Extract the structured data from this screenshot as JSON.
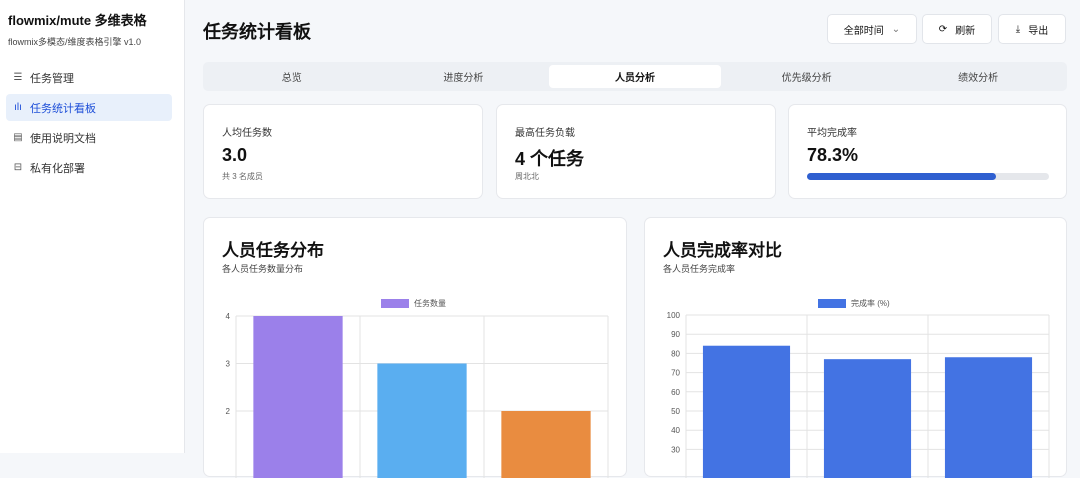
{
  "sidebar": {
    "brand": "flowmix/mute 多维表格",
    "subtitle": "flowmix多模态/维度表格引擎 v1.0",
    "items": [
      {
        "label": "任务管理",
        "icon": "database-icon"
      },
      {
        "label": "任务统计看板",
        "icon": "bar-chart-icon"
      },
      {
        "label": "使用说明文档",
        "icon": "document-icon"
      },
      {
        "label": "私有化部署",
        "icon": "server-icon"
      }
    ]
  },
  "header": {
    "title": "任务统计看板",
    "time_select": "全部时间",
    "refresh": "刷新",
    "export": "导出"
  },
  "tabs": [
    "总览",
    "进度分析",
    "人员分析",
    "优先级分析",
    "绩效分析"
  ],
  "stats": [
    {
      "label": "人均任务数",
      "value": "3.0",
      "sub": "共 3 名成员"
    },
    {
      "label": "最高任务负载",
      "value": "4 个任务",
      "sub": "周北北"
    },
    {
      "label": "平均完成率",
      "value": "78.3%",
      "progress": 78.3
    }
  ],
  "chart_data": [
    {
      "type": "bar",
      "title": "人员任务分布",
      "subtitle": "各人员任务数量分布",
      "legend": "任务数量",
      "categories": [
        "",
        "",
        ""
      ],
      "values": [
        4,
        3,
        2
      ],
      "colors": [
        "#9b80ea",
        "#5aaef0",
        "#e98c40"
      ],
      "yticks": [
        2,
        3,
        4
      ],
      "ylim": [
        0,
        4
      ]
    },
    {
      "type": "bar",
      "title": "人员完成率对比",
      "subtitle": "各人员任务完成率",
      "legend": "完成率 (%)",
      "categories": [
        "",
        "",
        ""
      ],
      "values": [
        84,
        77,
        78
      ],
      "colors": [
        "#4373e3",
        "#4373e3",
        "#4373e3"
      ],
      "yticks": [
        30,
        40,
        50,
        60,
        70,
        80,
        90,
        100
      ],
      "ylim": [
        0,
        100
      ]
    }
  ]
}
